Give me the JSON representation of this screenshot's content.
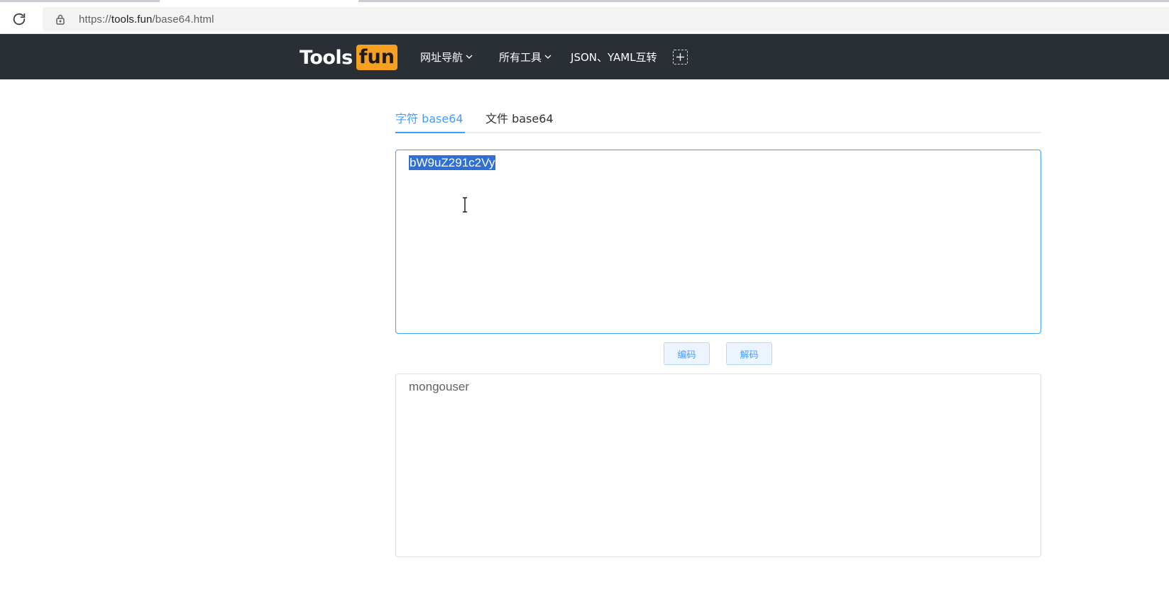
{
  "browser": {
    "url_scheme": "https://",
    "url_host": "tools.fun",
    "url_path": "/base64.html"
  },
  "header": {
    "logo_tools": "Tools",
    "logo_fun": "fun",
    "nav": [
      {
        "label": "网址导航"
      },
      {
        "label": "所有工具"
      },
      {
        "label": "JSON、YAML互转"
      }
    ]
  },
  "tabs": [
    {
      "label": "字符 base64",
      "active": true
    },
    {
      "label": "文件 base64",
      "active": false
    }
  ],
  "input": {
    "value": "bW9uZ291c2Vy",
    "selected": true
  },
  "buttons": {
    "encode": "编码",
    "decode": "解码"
  },
  "output": {
    "value": "mongouser"
  },
  "colors": {
    "accent": "#409eff",
    "header_bg": "#2a2e35",
    "logo_badge": "#f5a020",
    "selection": "#2f6fd6"
  }
}
